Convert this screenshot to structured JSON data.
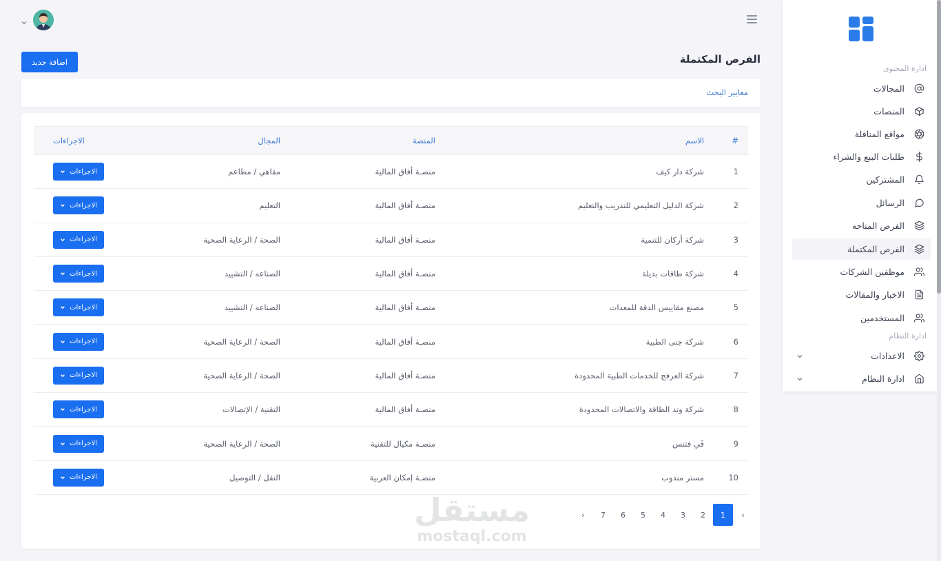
{
  "sidebar": {
    "section_content": "ادارة المحتوى",
    "section_system": "ادارة النظام",
    "items": [
      {
        "label": "المجالات",
        "icon": "at-icon"
      },
      {
        "label": "المنصات",
        "icon": "box-icon"
      },
      {
        "label": "مواقع المناقلة",
        "icon": "aperture-icon"
      },
      {
        "label": "طلبات البيع والشراء",
        "icon": "dollar-icon"
      },
      {
        "label": "المشتركين",
        "icon": "bell-icon"
      },
      {
        "label": "الرسائل",
        "icon": "message-icon"
      },
      {
        "label": "الفرص المتاحه",
        "icon": "layers-icon"
      },
      {
        "label": "الفرص المكتملة",
        "icon": "layers-icon"
      },
      {
        "label": "موظفين الشركات",
        "icon": "users-icon"
      },
      {
        "label": "الاخبار والمقالات",
        "icon": "file-text-icon"
      },
      {
        "label": "المستخدمين",
        "icon": "users-icon"
      },
      {
        "label": "الاعدادات",
        "icon": "gear-icon"
      },
      {
        "label": "ادارة النظام",
        "icon": "home-icon"
      }
    ],
    "active_index": 7
  },
  "page": {
    "title": "الفرص المكتملة",
    "add_button": "اضافة جديد",
    "filter_link": "معايير البحث"
  },
  "table": {
    "headers": {
      "num": "#",
      "name": "الاسم",
      "platform": "المنصة",
      "field": "المجال",
      "actions": "الاجراءات"
    },
    "action_label": "الاجراءات",
    "rows": [
      {
        "num": "1",
        "name": "شركة دار كيف",
        "platform": "منصـة أفاق المالية",
        "field": "مقاهي / مطاعم"
      },
      {
        "num": "2",
        "name": "شركة الدليل التعليمي للتدريب والتعليم",
        "platform": "منصـة أفاق المالية",
        "field": "التعليم"
      },
      {
        "num": "3",
        "name": "شركة أركان للتنمية",
        "platform": "منصـة أفاق المالية",
        "field": "الصحة / الرعاية الصحية"
      },
      {
        "num": "4",
        "name": "شركة طاقات بديلة",
        "platform": "منصـة أفاق المالية",
        "field": "الصناعه / التشييد"
      },
      {
        "num": "5",
        "name": "مصنع مقاييس الدقة للمعدات",
        "platform": "منصـة أفاق المالية",
        "field": "الصناعه / التشييد"
      },
      {
        "num": "6",
        "name": "شركة جنى الطبية",
        "platform": "منصـة أفاق المالية",
        "field": "الصحة / الرعاية الصحية"
      },
      {
        "num": "7",
        "name": "شركة العرفج للخدمات الطبية المحدودة",
        "platform": "منصـة أفاق المالية",
        "field": "الصحة / الرعاية الصحية"
      },
      {
        "num": "8",
        "name": "شركة وتد الطاقة والاتصالات المحدودة",
        "platform": "منصـة أفاق المالية",
        "field": "التقنية / الإتصالات"
      },
      {
        "num": "9",
        "name": "فَي فتنس",
        "platform": "منصـة مكيال للتقنية",
        "field": "الصحة / الرعاية الصحية"
      },
      {
        "num": "10",
        "name": "مستر مندوب",
        "platform": "منصـة إمكان العربية",
        "field": "النقل / التوصيل"
      }
    ]
  },
  "pagination": {
    "prev": "‹",
    "next": "›",
    "pages": [
      "1",
      "2",
      "3",
      "4",
      "5",
      "6",
      "7"
    ],
    "current": "1"
  },
  "watermark": {
    "arabic": "مستقل",
    "latin": "mostaql.com"
  },
  "colors": {
    "accent": "#1a6ef0",
    "link": "#3c79d6",
    "background": "#f5f5f9"
  }
}
